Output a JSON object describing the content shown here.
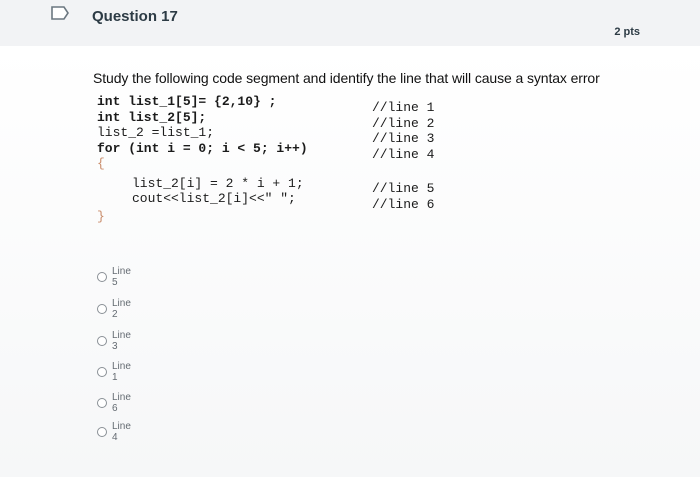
{
  "header": {
    "question_title": "Question 17",
    "points": "2 pts"
  },
  "question": {
    "prompt": "Study the following code segment and identify the line that will cause a syntax error",
    "code": {
      "line1": "int list_1[5]= {2,10} ;",
      "line2": "int list_2[5];",
      "line3": "list_2 =list_1;",
      "line4": "for (int i = 0; i < 5; i++)",
      "open_brace": "{",
      "line5": "list_2[i] = 2 * i + 1;",
      "line6": "cout<<list_2[i]<<\" \";",
      "close_brace": "}"
    },
    "comments": [
      "//line 1",
      "//line 2",
      "//line 3",
      "//line 4",
      "//line 5",
      "//line 6"
    ]
  },
  "options": [
    {
      "label": "Line 5"
    },
    {
      "label": "Line 2"
    },
    {
      "label": "Line 3"
    },
    {
      "label": "Line 1"
    },
    {
      "label": "Line 6"
    },
    {
      "label": "Line 4"
    }
  ],
  "colors": {
    "header_bg": "#f2f3f5",
    "text": "#2d3b45",
    "border": "#c7cdd1"
  }
}
